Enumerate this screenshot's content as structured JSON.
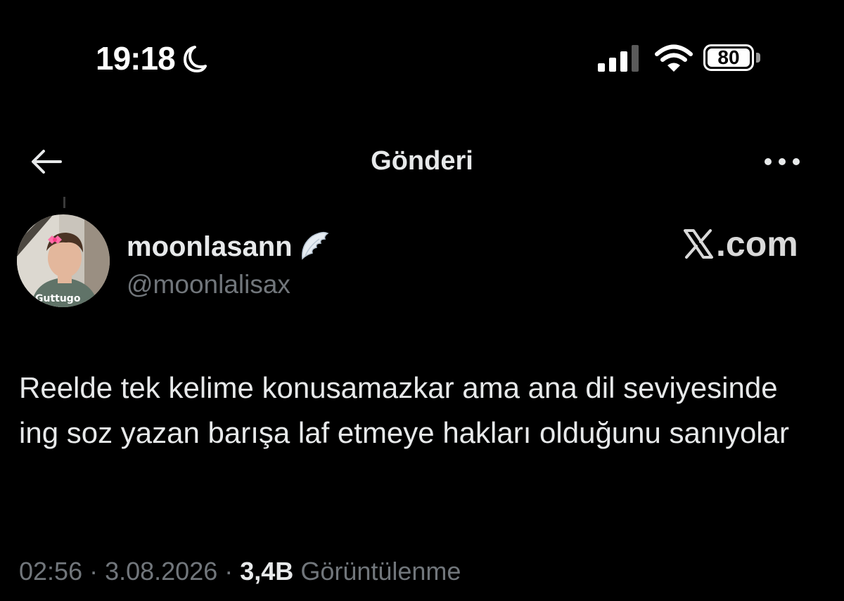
{
  "status_bar": {
    "time": "19:18",
    "battery": "80",
    "icons": [
      "moon-icon",
      "cellular-signal-icon",
      "wifi-icon",
      "battery-icon"
    ]
  },
  "header": {
    "title": "Gönderi",
    "back_icon": "back-arrow-icon",
    "more_icon": "more-options-icon"
  },
  "author": {
    "display_name": "moonlasann",
    "handle": "@moonlalisax",
    "avatar_caption": "Guttugo",
    "badge_icon": "angel-wing-icon"
  },
  "watermark": {
    "text": ".com",
    "logo_icon": "x-logo-icon"
  },
  "tweet": {
    "text": "Reelde tek kelime konusamazkar ama ana dil seviyesinde ing soz yazan barışa laf etmeye hakları olduğunu sanıyolar"
  },
  "meta": {
    "time": "02:56",
    "separator": " · ",
    "date": "3.08.2026",
    "views_count": "3,4B",
    "views_label": "Görüntülenme"
  },
  "colors": {
    "background": "#000000",
    "primary_text": "#e7e9ea",
    "secondary_text": "#71767b"
  }
}
